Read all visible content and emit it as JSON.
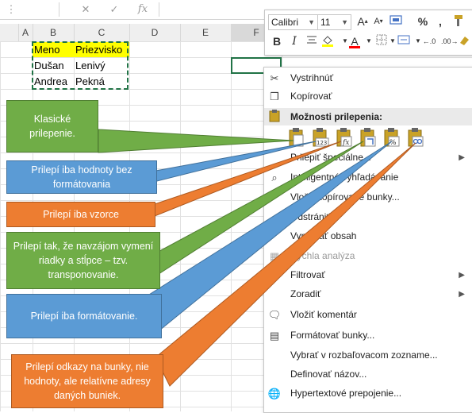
{
  "formula_bar": {
    "cancel_icon": "close-icon",
    "enter_icon": "check-icon",
    "fx_label": "fx"
  },
  "columns": [
    "A",
    "B",
    "C",
    "D",
    "E",
    "F"
  ],
  "cells": {
    "b1": "Meno",
    "c1": "Priezvisko",
    "b2": "Dušan",
    "c2": "Lenivý",
    "b3": "Andrea",
    "c3": "Pekná"
  },
  "mini_toolbar": {
    "font_name": "Calibri",
    "font_size": "11",
    "bold": "B",
    "italic": "I",
    "percent": "%",
    "comma": ",",
    "font_color_letter": "A",
    "grow_font": "A",
    "shrink_font": "A",
    "highlight_color": "#ffff00",
    "font_color": "#ff0000"
  },
  "context_menu": {
    "cut": "Vystrihnúť",
    "copy": "Kopírovať",
    "paste_options": "Možnosti prilepenia:",
    "paste_special": "Prilepiť špeciálne...",
    "smart_lookup": "Inteligentné vyhľadávanie",
    "insert_copied": "Vložiť kopírované bunky...",
    "delete": "Odstrániť...",
    "clear": "Vymazať obsah",
    "quick_analysis": "Rýchla analýza",
    "filter": "Filtrovať",
    "sort": "Zoradiť",
    "insert_comment": "Vložiť komentár",
    "format_cells": "Formátovať bunky...",
    "pick_list": "Vybrať v rozbaľovacom zozname...",
    "define_name": "Definovať názov...",
    "hyperlink": "Hypertextové prepojenie..."
  },
  "callouts": {
    "classic": "Klasické prilepenie.",
    "values": "Prilepí iba hodnoty bez formátovania",
    "formulas": "Prilepí iba vzorce",
    "transpose": "Prilepí tak, že navzájom vymení riadky a stĺpce – tzv. transponovanie.",
    "formatting": "Prilepí iba formátovanie.",
    "links": "Prilepí odkazy na bunky, nie hodnoty, ale relatívne adresy daných buniek."
  },
  "colors": {
    "green": "#70ad47",
    "blue": "#5b9bd5",
    "orange": "#ed7d31",
    "selected_cell_border": "#217346"
  }
}
